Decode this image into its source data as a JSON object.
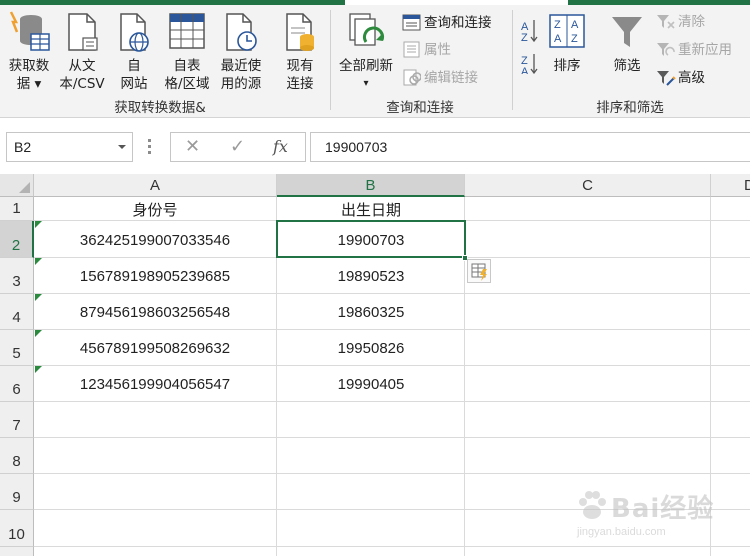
{
  "ribbon": {
    "get_data": {
      "items": [
        {
          "line1": "获取数",
          "line2": "据 ▾"
        },
        {
          "line1": "从文",
          "line2": "本/CSV"
        },
        {
          "line1": "自",
          "line2": "网站"
        },
        {
          "line1": "自表",
          "line2": "格/区域"
        },
        {
          "line1": "最近使",
          "line2": "用的源"
        },
        {
          "line1": "现有",
          "line2": "连接"
        }
      ],
      "group_label": "获取转换数据&"
    },
    "queries": {
      "refresh_all": {
        "line1": "全部刷新",
        "line2": "▾"
      },
      "queries_connections": "查询和连接",
      "properties": "属性",
      "edit_links": "编辑链接",
      "group_label": "查询和连接"
    },
    "sort_filter": {
      "sort": "排序",
      "filter": "筛选",
      "clear": "清除",
      "reapply": "重新应用",
      "advanced": "高级",
      "group_label": "排序和筛选"
    }
  },
  "formula_bar": {
    "name_box": "B2",
    "cancel": "✕",
    "enter": "✓",
    "fx": "fx",
    "value": "19900703"
  },
  "sheet": {
    "columns": [
      "A",
      "B",
      "C",
      "D"
    ],
    "selected_column": "B",
    "rows": [
      "1",
      "2",
      "3",
      "4",
      "5",
      "6",
      "7",
      "8",
      "9",
      "10"
    ],
    "selected_row": "2",
    "header_row": {
      "a": "身份号",
      "b": "出生日期"
    },
    "data": [
      {
        "a": "362425199007033546",
        "b": "19900703"
      },
      {
        "a": "156789198905239685",
        "b": "19890523"
      },
      {
        "a": "879456198603256548",
        "b": "19860325"
      },
      {
        "a": "456789199508269632",
        "b": "19950826"
      },
      {
        "a": "123456199904056547",
        "b": "19990405"
      }
    ],
    "active_cell": "B2"
  },
  "colors": {
    "accent": "#217346",
    "error_marker": "#2a8a3e"
  },
  "watermark": {
    "brand": "Bai经验",
    "url": "jingyan.baidu.com"
  }
}
